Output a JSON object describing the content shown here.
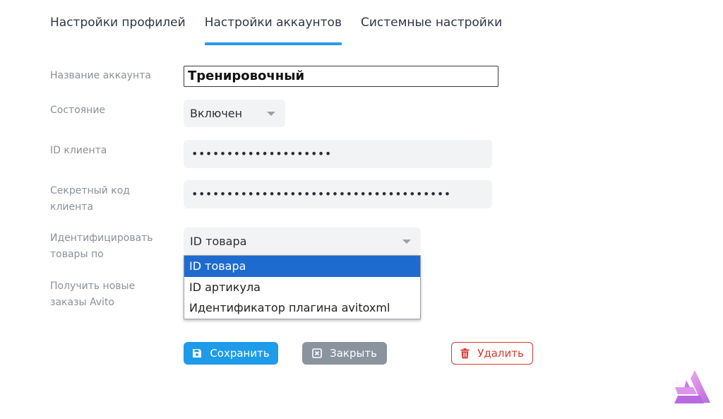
{
  "tabs": [
    {
      "label": "Настройки профилей",
      "active": false
    },
    {
      "label": "Настройки аккаунтов",
      "active": true
    },
    {
      "label": "Системные настройки",
      "active": false
    }
  ],
  "form": {
    "account_name": {
      "label": "Название аккаунта",
      "value": "Тренировочный"
    },
    "state": {
      "label": "Состояние",
      "value": "Включен"
    },
    "client_id": {
      "label": "ID клиента",
      "value": "••••••••••••••••••••"
    },
    "client_secret": {
      "label": "Секретный код клиента",
      "value": "•••••••••••••••••••••••••••••••••••••"
    },
    "identify_by": {
      "label": "Идентифицировать товары по",
      "value": "ID товара",
      "options": [
        "ID товара",
        "ID артикула",
        "Идентификатор плагина avitoxml"
      ]
    },
    "get_orders": {
      "label": "Получить новые заказы Avito"
    }
  },
  "buttons": {
    "save": "Сохранить",
    "close": "Закрыть",
    "delete": "Удалить"
  },
  "icons": {
    "save": "floppy-disk-icon",
    "close": "close-square-icon",
    "delete": "trash-icon",
    "logo": "app-logo-icon"
  },
  "colors": {
    "accent": "#2a9bea",
    "save_button": "#1e9be9",
    "close_button": "#8a949e",
    "delete_button": "#d53b2f",
    "selected_option": "#1e6bd0"
  }
}
